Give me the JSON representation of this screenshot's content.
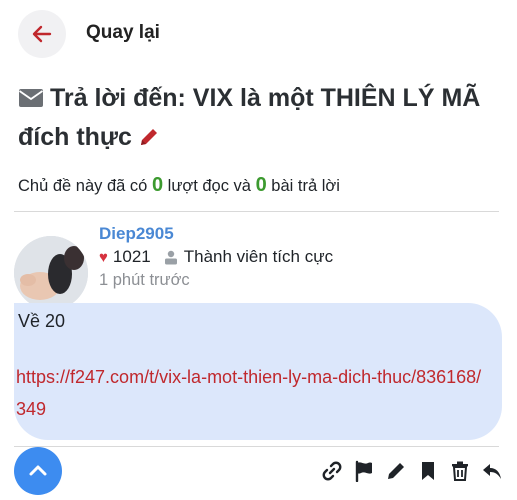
{
  "header": {
    "back_label": "Quay lại"
  },
  "topic": {
    "title": "Trả lời đến: VIX là một THIÊN LÝ MÃ đích thực"
  },
  "stats": {
    "prefix": "Chủ đề này đã có",
    "views": "0",
    "middle": "lượt đọc và",
    "replies": "0",
    "suffix": "bài trả lời"
  },
  "post": {
    "username": "Diep2905",
    "likes": "1021",
    "rank": "Thành viên tích cực",
    "posted_time": "1 phút trước",
    "body_text": "Về 20",
    "link": "https://f247.com/t/vix-la-mot-thien-ly-ma-dich-thuc/836168/349"
  },
  "colors": {
    "accent_red": "#c0282d",
    "username_blue": "#4a88d4",
    "count_green": "#3c9a2f",
    "bubble_bg": "#dce7fb",
    "scroll_button": "#3d8cf0"
  },
  "icons": {
    "back": "arrow-left-icon",
    "title_prefix": "envelope-icon",
    "title_suffix": "pencil-icon",
    "likes": "heart-icon",
    "rank": "user-rank-icon",
    "scroll": "chevron-up-icon",
    "actions": [
      "link-icon",
      "flag-icon",
      "edit-icon",
      "bookmark-icon",
      "trash-icon",
      "reply-icon"
    ]
  }
}
